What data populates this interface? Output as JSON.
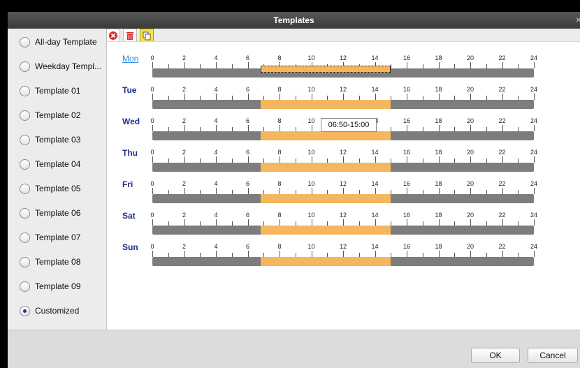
{
  "window": {
    "title": "Templates",
    "close_glyph": "×"
  },
  "templates": [
    {
      "label": "All-day Template",
      "checked": false
    },
    {
      "label": "Weekday Templ...",
      "checked": false
    },
    {
      "label": "Template 01",
      "checked": false
    },
    {
      "label": "Template 02",
      "checked": false
    },
    {
      "label": "Template 03",
      "checked": false
    },
    {
      "label": "Template 04",
      "checked": false
    },
    {
      "label": "Template 05",
      "checked": false
    },
    {
      "label": "Template 06",
      "checked": false
    },
    {
      "label": "Template 07",
      "checked": false
    },
    {
      "label": "Template 08",
      "checked": false
    },
    {
      "label": "Template 09",
      "checked": false
    },
    {
      "label": "Customized",
      "checked": true
    }
  ],
  "toolbar": {
    "buttons": [
      {
        "icon": "delete-icon",
        "color": "#d9302c"
      },
      {
        "icon": "trash-icon",
        "color": "#d9302c"
      },
      {
        "icon": "copy-icon",
        "color": "#f4e24a"
      }
    ]
  },
  "ruler_ticks": [
    "0",
    "2",
    "4",
    "6",
    "8",
    "10",
    "12",
    "14",
    "16",
    "18",
    "20",
    "22",
    "24"
  ],
  "schedule": [
    {
      "day": "Mon",
      "active": true,
      "start": 6.83,
      "end": 15.0,
      "selected": true
    },
    {
      "day": "Tue",
      "active": false,
      "start": 6.83,
      "end": 15.0
    },
    {
      "day": "Wed",
      "active": false,
      "start": 6.83,
      "end": 15.0
    },
    {
      "day": "Thu",
      "active": false,
      "start": 6.83,
      "end": 15.0
    },
    {
      "day": "Fri",
      "active": false,
      "start": 6.83,
      "end": 15.0
    },
    {
      "day": "Sat",
      "active": false,
      "start": 6.83,
      "end": 15.0
    },
    {
      "day": "Sun",
      "active": false,
      "start": 6.83,
      "end": 15.0
    }
  ],
  "tooltip": "06:50-15:00",
  "footer": {
    "ok_label": "OK",
    "cancel_label": "Cancel"
  },
  "colors": {
    "segment": "#f5b660",
    "bar": "#7d7d7d",
    "day_label": "#1e2f8c",
    "day_active": "#3a8ed8"
  }
}
